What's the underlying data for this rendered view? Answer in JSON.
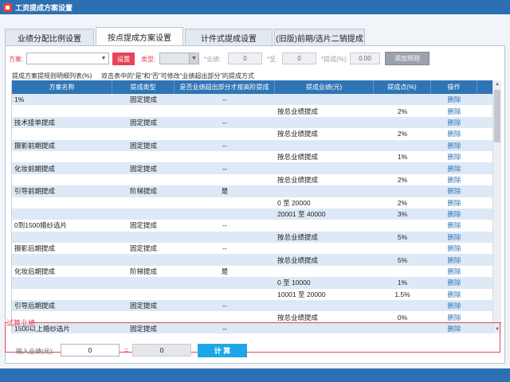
{
  "window": {
    "title": "工资提成方案设置"
  },
  "tabs": [
    {
      "label": "业绩分配比例设置"
    },
    {
      "label": "按点提成方案设置"
    },
    {
      "label": "计件式提成设置"
    },
    {
      "label": "(旧版)前期/选片二销提成"
    }
  ],
  "toolbar": {
    "scheme_label": "方案:",
    "scheme_value": "",
    "set_button": "设置",
    "type_label": "类型:",
    "type_value": "",
    "perf_label": "*业绩:",
    "perf_value": "0",
    "to_label": "*至:",
    "to_value": "0",
    "commission_label": "*提成(%):",
    "commission_value": "0.00",
    "add_rule_button": "添加规则"
  },
  "group": {
    "title": "提成方案提规则明细列表(%)",
    "hint": "双击表中的“是”和“否”可修改“业绩超出部分”的提成方式"
  },
  "table": {
    "columns": [
      "方案名称",
      "提成类型",
      "是否业绩超出部分才按高阶提成",
      "提成业绩(元)",
      "提成点(%)",
      "操作"
    ],
    "rows": [
      [
        "1%",
        "固定提成",
        "--",
        "",
        "",
        "删除"
      ],
      [
        "",
        "",
        "",
        "按总业绩提成",
        "2%",
        "删除"
      ],
      [
        "技术接单提成",
        "固定提成",
        "--",
        "",
        "",
        "删除"
      ],
      [
        "",
        "",
        "",
        "按总业绩提成",
        "2%",
        "删除"
      ],
      [
        "摄影前期提成",
        "固定提成",
        "--",
        "",
        "",
        "删除"
      ],
      [
        "",
        "",
        "",
        "按总业绩提成",
        "1%",
        "删除"
      ],
      [
        "化妆前期提成",
        "固定提成",
        "--",
        "",
        "",
        "删除"
      ],
      [
        "",
        "",
        "",
        "按总业绩提成",
        "2%",
        "删除"
      ],
      [
        "引导前期提成",
        "阶梯提成",
        "是",
        "",
        "",
        "删除"
      ],
      [
        "",
        "",
        "",
        "0 至 20000",
        "2%",
        "删除"
      ],
      [
        "",
        "",
        "",
        "20001 至 40000",
        "3%",
        "删除"
      ],
      [
        "0到1500婚纱选片",
        "固定提成",
        "--",
        "",
        "",
        "删除"
      ],
      [
        "",
        "",
        "",
        "按总业绩提成",
        "5%",
        "删除"
      ],
      [
        "摄影后期提成",
        "固定提成",
        "--",
        "",
        "",
        "删除"
      ],
      [
        "",
        "",
        "",
        "按总业绩提成",
        "5%",
        "删除"
      ],
      [
        "化妆后期提成",
        "阶梯提成",
        "是",
        "",
        "",
        "删除"
      ],
      [
        "",
        "",
        "",
        "0 至 10000",
        "1%",
        "删除"
      ],
      [
        "",
        "",
        "",
        "10001 至 20000",
        "1.5%",
        "删除"
      ],
      [
        "引导后期提成",
        "固定提成",
        "--",
        "",
        "",
        "删除"
      ],
      [
        "",
        "",
        "",
        "按总业绩提成",
        "0%",
        "删除"
      ],
      [
        "1500以上婚纱选片",
        "固定提成",
        "--",
        "",
        "",
        "删除"
      ]
    ]
  },
  "calc": {
    "title": "试算业绩",
    "input_label": "输入业绩(元):",
    "input_value": "0",
    "equals": "=",
    "result_value": "0",
    "button": "计 算"
  }
}
